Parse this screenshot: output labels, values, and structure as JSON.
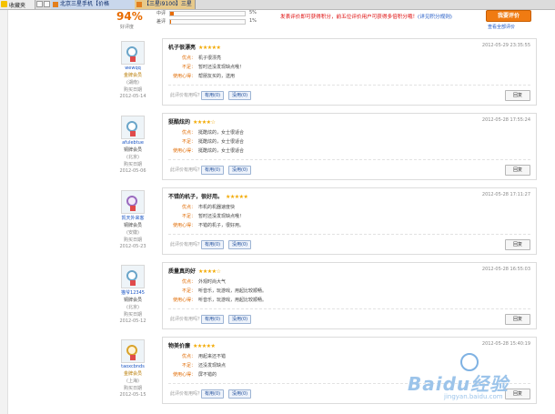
{
  "tabs": {
    "favorites": "收藏夹",
    "tab1": "北京三星手机【价格",
    "tab2": "【三星i9100】三星"
  },
  "summary": {
    "score": "94%",
    "score_caption": "好评度",
    "rates": [
      {
        "label": "中评",
        "pct": "5%",
        "value": 0.05
      },
      {
        "label": "差评",
        "pct": "1%",
        "value": 0.01
      }
    ],
    "notice_red": "发表评价即可获得积分，前五位评价用户可获得多倍积分哦！",
    "notice_link": "(详见积分规则)",
    "write_button": "我要评价",
    "view_all": "查看全部评价"
  },
  "ui": {
    "helpful_question": "此评价有用吗？",
    "reply": "回复",
    "member_since": "购买日期",
    "key_pros": "优点：",
    "key_cons": "不足：",
    "key_feel": "使用心得："
  },
  "reviews": [
    {
      "user": "wewqq",
      "level": "金牌会员",
      "level_class": "gold",
      "location": "(湖南)",
      "date": "2012-05-14",
      "title": "机子很漂亮",
      "stars": "★★★★★",
      "time": "2012-05-29 23:35:55",
      "pros": "机子很漂亮",
      "cons": "暂时还没发现缺点哦！",
      "feel": "帮朋友买的，送用",
      "useful": "有用(0)",
      "useless": "没用(0)",
      "badge": "disc"
    },
    {
      "user": "afulebtue",
      "level": "铜牌会员",
      "level_class": "",
      "location": "(北京)",
      "date": "2012-05-06",
      "title": "挺酷炫的",
      "stars": "★★★★☆",
      "time": "2012-05-28 17:55:24",
      "pros": "挺酷炫的，女士很适合",
      "cons": "挺酷炫的，女士很适合",
      "feel": "挺酷炫的，女士很适合",
      "useful": "有用(0)",
      "useless": "没用(0)",
      "badge": "disc"
    },
    {
      "user": "凯天外来客",
      "level": "铜牌会员",
      "level_class": "",
      "location": "(安徽)",
      "date": "2012-05-23",
      "title": "不错的机子，很好用。",
      "stars": "★★★★★",
      "time": "2012-05-28 17:11:27",
      "pros": "市机的机器速度快",
      "cons": "暂时还没发现缺点哦！",
      "feel": "不错的机子，很好用。",
      "useful": "有用(0)",
      "useless": "没用(0)",
      "badge": "purple"
    },
    {
      "user": "猫爷12345",
      "level": "铜牌会员",
      "level_class": "",
      "location": "(北京)",
      "date": "2012-05-12",
      "title": "质量真的好",
      "stars": "★★★★☆",
      "time": "2012-05-28 16:55:03",
      "pros": "外观时尚大气",
      "cons": "听音乐，玩游戏，用起比较顺畅。",
      "feel": "听音乐，玩游戏，用起比较顺畅。",
      "useful": "有用(0)",
      "useless": "没用(0)",
      "badge": "disc"
    },
    {
      "user": "taoxcbnds",
      "level": "金牌会员",
      "level_class": "gold",
      "location": "(上海)",
      "date": "2012-05-15",
      "title": "物美价廉",
      "stars": "★★★★★",
      "time": "2012-05-28 15:40:19",
      "pros": "用起来还不错",
      "cons": "还没发现缺点",
      "feel": "屏不错的",
      "useful": "有用(0)",
      "useless": "没用(0)",
      "badge": "gold"
    }
  ],
  "watermark": {
    "text": "Baidu经验",
    "url": "jingyan.baidu.com"
  }
}
